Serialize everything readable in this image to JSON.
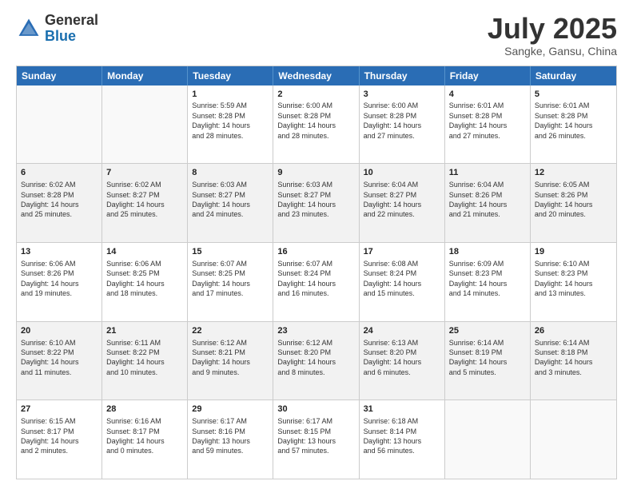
{
  "logo": {
    "general": "General",
    "blue": "Blue"
  },
  "title": "July 2025",
  "location": "Sangke, Gansu, China",
  "days_of_week": [
    "Sunday",
    "Monday",
    "Tuesday",
    "Wednesday",
    "Thursday",
    "Friday",
    "Saturday"
  ],
  "rows": [
    [
      {
        "day": "",
        "lines": []
      },
      {
        "day": "",
        "lines": []
      },
      {
        "day": "1",
        "lines": [
          "Sunrise: 5:59 AM",
          "Sunset: 8:28 PM",
          "Daylight: 14 hours",
          "and 28 minutes."
        ]
      },
      {
        "day": "2",
        "lines": [
          "Sunrise: 6:00 AM",
          "Sunset: 8:28 PM",
          "Daylight: 14 hours",
          "and 28 minutes."
        ]
      },
      {
        "day": "3",
        "lines": [
          "Sunrise: 6:00 AM",
          "Sunset: 8:28 PM",
          "Daylight: 14 hours",
          "and 27 minutes."
        ]
      },
      {
        "day": "4",
        "lines": [
          "Sunrise: 6:01 AM",
          "Sunset: 8:28 PM",
          "Daylight: 14 hours",
          "and 27 minutes."
        ]
      },
      {
        "day": "5",
        "lines": [
          "Sunrise: 6:01 AM",
          "Sunset: 8:28 PM",
          "Daylight: 14 hours",
          "and 26 minutes."
        ]
      }
    ],
    [
      {
        "day": "6",
        "lines": [
          "Sunrise: 6:02 AM",
          "Sunset: 8:28 PM",
          "Daylight: 14 hours",
          "and 25 minutes."
        ]
      },
      {
        "day": "7",
        "lines": [
          "Sunrise: 6:02 AM",
          "Sunset: 8:27 PM",
          "Daylight: 14 hours",
          "and 25 minutes."
        ]
      },
      {
        "day": "8",
        "lines": [
          "Sunrise: 6:03 AM",
          "Sunset: 8:27 PM",
          "Daylight: 14 hours",
          "and 24 minutes."
        ]
      },
      {
        "day": "9",
        "lines": [
          "Sunrise: 6:03 AM",
          "Sunset: 8:27 PM",
          "Daylight: 14 hours",
          "and 23 minutes."
        ]
      },
      {
        "day": "10",
        "lines": [
          "Sunrise: 6:04 AM",
          "Sunset: 8:27 PM",
          "Daylight: 14 hours",
          "and 22 minutes."
        ]
      },
      {
        "day": "11",
        "lines": [
          "Sunrise: 6:04 AM",
          "Sunset: 8:26 PM",
          "Daylight: 14 hours",
          "and 21 minutes."
        ]
      },
      {
        "day": "12",
        "lines": [
          "Sunrise: 6:05 AM",
          "Sunset: 8:26 PM",
          "Daylight: 14 hours",
          "and 20 minutes."
        ]
      }
    ],
    [
      {
        "day": "13",
        "lines": [
          "Sunrise: 6:06 AM",
          "Sunset: 8:26 PM",
          "Daylight: 14 hours",
          "and 19 minutes."
        ]
      },
      {
        "day": "14",
        "lines": [
          "Sunrise: 6:06 AM",
          "Sunset: 8:25 PM",
          "Daylight: 14 hours",
          "and 18 minutes."
        ]
      },
      {
        "day": "15",
        "lines": [
          "Sunrise: 6:07 AM",
          "Sunset: 8:25 PM",
          "Daylight: 14 hours",
          "and 17 minutes."
        ]
      },
      {
        "day": "16",
        "lines": [
          "Sunrise: 6:07 AM",
          "Sunset: 8:24 PM",
          "Daylight: 14 hours",
          "and 16 minutes."
        ]
      },
      {
        "day": "17",
        "lines": [
          "Sunrise: 6:08 AM",
          "Sunset: 8:24 PM",
          "Daylight: 14 hours",
          "and 15 minutes."
        ]
      },
      {
        "day": "18",
        "lines": [
          "Sunrise: 6:09 AM",
          "Sunset: 8:23 PM",
          "Daylight: 14 hours",
          "and 14 minutes."
        ]
      },
      {
        "day": "19",
        "lines": [
          "Sunrise: 6:10 AM",
          "Sunset: 8:23 PM",
          "Daylight: 14 hours",
          "and 13 minutes."
        ]
      }
    ],
    [
      {
        "day": "20",
        "lines": [
          "Sunrise: 6:10 AM",
          "Sunset: 8:22 PM",
          "Daylight: 14 hours",
          "and 11 minutes."
        ]
      },
      {
        "day": "21",
        "lines": [
          "Sunrise: 6:11 AM",
          "Sunset: 8:22 PM",
          "Daylight: 14 hours",
          "and 10 minutes."
        ]
      },
      {
        "day": "22",
        "lines": [
          "Sunrise: 6:12 AM",
          "Sunset: 8:21 PM",
          "Daylight: 14 hours",
          "and 9 minutes."
        ]
      },
      {
        "day": "23",
        "lines": [
          "Sunrise: 6:12 AM",
          "Sunset: 8:20 PM",
          "Daylight: 14 hours",
          "and 8 minutes."
        ]
      },
      {
        "day": "24",
        "lines": [
          "Sunrise: 6:13 AM",
          "Sunset: 8:20 PM",
          "Daylight: 14 hours",
          "and 6 minutes."
        ]
      },
      {
        "day": "25",
        "lines": [
          "Sunrise: 6:14 AM",
          "Sunset: 8:19 PM",
          "Daylight: 14 hours",
          "and 5 minutes."
        ]
      },
      {
        "day": "26",
        "lines": [
          "Sunrise: 6:14 AM",
          "Sunset: 8:18 PM",
          "Daylight: 14 hours",
          "and 3 minutes."
        ]
      }
    ],
    [
      {
        "day": "27",
        "lines": [
          "Sunrise: 6:15 AM",
          "Sunset: 8:17 PM",
          "Daylight: 14 hours",
          "and 2 minutes."
        ]
      },
      {
        "day": "28",
        "lines": [
          "Sunrise: 6:16 AM",
          "Sunset: 8:17 PM",
          "Daylight: 14 hours",
          "and 0 minutes."
        ]
      },
      {
        "day": "29",
        "lines": [
          "Sunrise: 6:17 AM",
          "Sunset: 8:16 PM",
          "Daylight: 13 hours",
          "and 59 minutes."
        ]
      },
      {
        "day": "30",
        "lines": [
          "Sunrise: 6:17 AM",
          "Sunset: 8:15 PM",
          "Daylight: 13 hours",
          "and 57 minutes."
        ]
      },
      {
        "day": "31",
        "lines": [
          "Sunrise: 6:18 AM",
          "Sunset: 8:14 PM",
          "Daylight: 13 hours",
          "and 56 minutes."
        ]
      },
      {
        "day": "",
        "lines": []
      },
      {
        "day": "",
        "lines": []
      }
    ]
  ]
}
